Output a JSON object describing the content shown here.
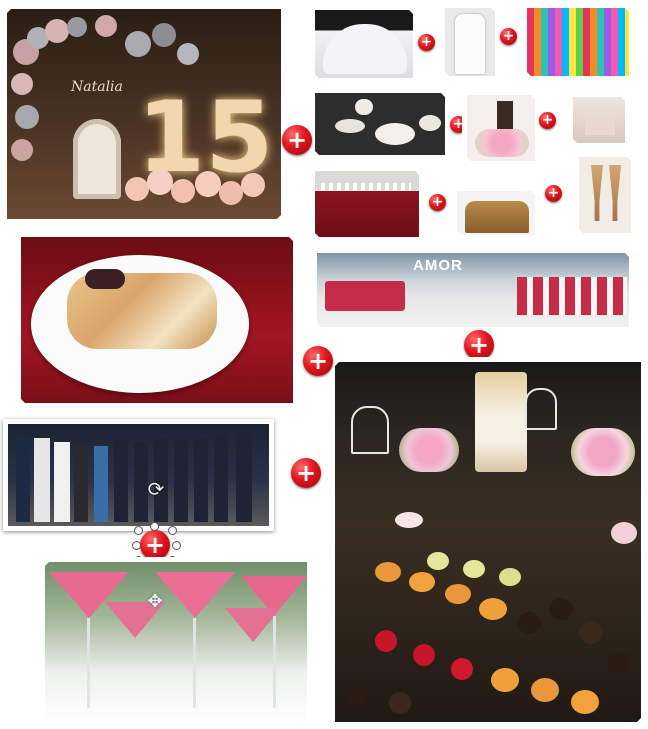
{
  "collage": {
    "quince_sign_name": "Natalia",
    "quince_number": "15",
    "salon_sign": "AMOR"
  },
  "controls": {
    "plus_symbol": "+",
    "rotate_symbol": "⟳",
    "move_symbol": "✥"
  },
  "icons": [
    "plus-icon",
    "rotate-icon",
    "move-icon"
  ],
  "colors": {
    "accent_red": "#e0141c",
    "frame_white": "#ffffff",
    "tablecloth_red": "#8a1420",
    "cocktail_pink": "#e86a8e"
  }
}
